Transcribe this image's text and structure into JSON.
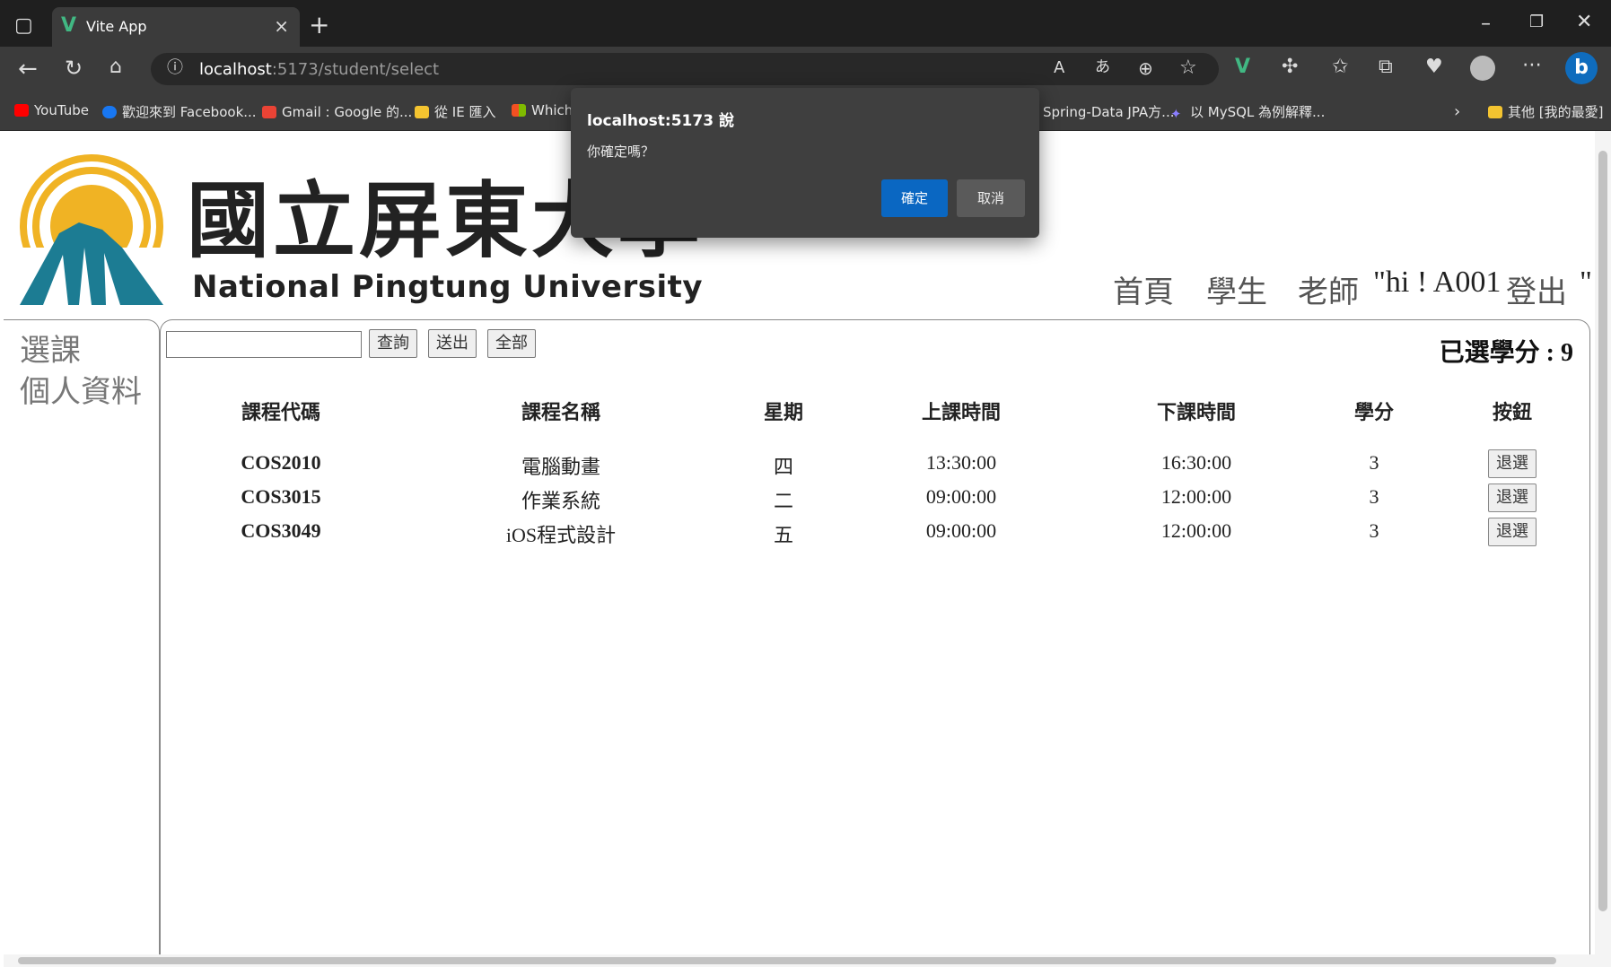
{
  "browser": {
    "tab_title": "Vite App",
    "url_host": "localhost",
    "url_path": ":5173/student/select",
    "bookmarks": [
      {
        "label": "YouTube",
        "icon": "youtube-icon",
        "color": "#ff0000"
      },
      {
        "label": "歡迎來到 Facebook...",
        "icon": "facebook-icon",
        "color": "#1877f2"
      },
      {
        "label": "Gmail : Google 的...",
        "icon": "gmail-icon",
        "color": "#ea4335"
      },
      {
        "label": "從 IE 匯入",
        "icon": "folder-icon",
        "color": "#f4c430"
      },
      {
        "label": "Which",
        "icon": "microsoft-icon",
        "color": "#f25022"
      },
      {
        "label": "Spring-Data JPA方...",
        "icon": "page-icon",
        "color": "#888888"
      },
      {
        "label": "以 MySQL 為例解釋...",
        "icon": "sparkle-icon",
        "color": "#8a7dff"
      }
    ],
    "other_bookmarks": "其他 [我的最愛]"
  },
  "header": {
    "brand_cn": "國立屏東大學",
    "brand_en": "National Pingtung University",
    "nav": [
      "首頁",
      "學生",
      "老師"
    ],
    "greeting": "\"hi ! A001",
    "logout": "登出",
    "trailing": "\""
  },
  "sidebar": {
    "items": [
      "選課",
      "個人資料"
    ]
  },
  "toolbar": {
    "search_value": "",
    "query_label": "查詢",
    "submit_label": "送出",
    "all_label": "全部"
  },
  "credits_text": "已選學分 : 9",
  "table": {
    "headers": [
      "課程代碼",
      "課程名稱",
      "星期",
      "上課時間",
      "下課時間",
      "學分",
      "按鈕"
    ],
    "rows": [
      {
        "code": "COS2010",
        "name": "電腦動畫",
        "day": "四",
        "start": "13:30:00",
        "end": "16:30:00",
        "credit": "3",
        "action": "退選"
      },
      {
        "code": "COS3015",
        "name": "作業系統",
        "day": "二",
        "start": "09:00:00",
        "end": "12:00:00",
        "credit": "3",
        "action": "退選"
      },
      {
        "code": "COS3049",
        "name": "iOS程式設計",
        "day": "五",
        "start": "09:00:00",
        "end": "12:00:00",
        "credit": "3",
        "action": "退選"
      }
    ]
  },
  "dialog": {
    "title": "localhost:5173 說",
    "message": "你確定嗎？",
    "ok_label": "確定",
    "cancel_label": "取消"
  }
}
